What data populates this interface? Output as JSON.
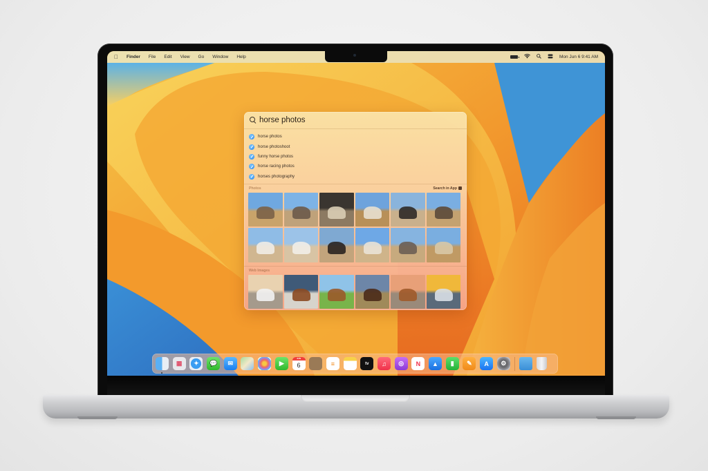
{
  "menubar": {
    "apple_icon": "apple-logo-icon",
    "app_name": "Finder",
    "items": [
      "File",
      "Edit",
      "View",
      "Go",
      "Window",
      "Help"
    ],
    "status_icons": [
      "battery-icon",
      "wifi-icon",
      "search-icon",
      "control-center-icon"
    ],
    "datetime": "Mon Jun 6  9:41 AM"
  },
  "spotlight": {
    "query": "horse photos",
    "suggestions": [
      {
        "label": "horse photos",
        "icon": "safari-icon"
      },
      {
        "label": "horse photoshoot",
        "icon": "safari-icon"
      },
      {
        "label": "funny horse photos",
        "icon": "safari-icon"
      },
      {
        "label": "horse racing photos",
        "icon": "safari-icon"
      },
      {
        "label": "horses photography",
        "icon": "safari-icon"
      }
    ],
    "photos_section": {
      "title": "Photos",
      "action": "Search in App",
      "thumbnails": [
        "girl riding horse in field",
        "girl on horse with hat",
        "horse in barn",
        "rider on horse in distance",
        "girl with dark horse",
        "girl leading grey horse",
        "girl hugging white horse",
        "girl with white horse",
        "girl with dark horse close-up",
        "girl riding palomino",
        "girl with horse and hat",
        "girl riding in field"
      ]
    },
    "web_images_section": {
      "title": "Web Images",
      "thumbnails": [
        "white horses running in water",
        "brown horse galloping",
        "horses running on grass",
        "herd grazing at sunset",
        "horses on beach",
        "white horses at sunrise"
      ]
    }
  },
  "dock": {
    "apps": [
      {
        "name": "Finder",
        "running": true
      },
      {
        "name": "Launchpad",
        "running": false
      },
      {
        "name": "Safari",
        "running": false
      },
      {
        "name": "Messages",
        "running": false
      },
      {
        "name": "Mail",
        "running": false
      },
      {
        "name": "Maps",
        "running": false
      },
      {
        "name": "Photos",
        "running": false
      },
      {
        "name": "FaceTime",
        "running": false
      },
      {
        "name": "Calendar",
        "running": false,
        "day": "6",
        "month": "JUN"
      },
      {
        "name": "Contacts",
        "running": false
      },
      {
        "name": "Reminders",
        "running": false
      },
      {
        "name": "Notes",
        "running": false
      },
      {
        "name": "TV",
        "running": false,
        "label": "tv"
      },
      {
        "name": "Music",
        "running": false
      },
      {
        "name": "Podcasts",
        "running": false
      },
      {
        "name": "News",
        "running": false
      },
      {
        "name": "Keynote",
        "running": false
      },
      {
        "name": "Numbers",
        "running": false
      },
      {
        "name": "Pages",
        "running": false
      },
      {
        "name": "App Store",
        "running": false
      },
      {
        "name": "System Settings",
        "running": false
      }
    ],
    "stacks": [
      {
        "name": "Downloads"
      },
      {
        "name": "Trash"
      }
    ]
  },
  "colors": {
    "wallpaper_orange": "#f08a24",
    "wallpaper_yellow": "#f8c244",
    "wallpaper_blue": "#3f8fd2",
    "dock_blue_finder": "#2f8cf0"
  }
}
